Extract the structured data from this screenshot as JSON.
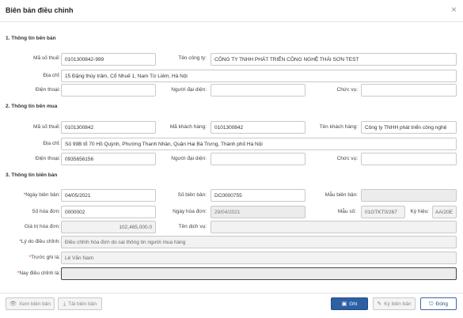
{
  "dialog": {
    "title": "Biên bản điều chỉnh"
  },
  "seller": {
    "section_title": "1. Thông tin bên bán",
    "tax_code_label": "Mã số thuế:",
    "tax_code": "0101300842-999",
    "company_label": "Tên công ty:",
    "company": "CÔNG TY TNHH PHÁT TRIỂN CÔNG NGHỆ THÁI SƠN TEST",
    "address_label": "Địa chỉ:",
    "address": "15 Đặng thùy trâm, Cổ Nhuế 1, Nam Từ Liêm, Hà Nội",
    "phone_label": "Điện thoại:",
    "phone": "",
    "rep_label": "Người đại diện:",
    "rep": "",
    "position_label": "Chức vụ:",
    "position": ""
  },
  "buyer": {
    "section_title": "2. Thông tin bên mua",
    "tax_code_label": "Mã số thuế:",
    "tax_code": "0101300842",
    "customer_code_label": "Mã khách hàng:",
    "customer_code": "0101300842",
    "customer_name_label": "Tên khách hàng:",
    "customer_name": "Công ty TNHH phát triển công nghệ",
    "address_label": "Địa chỉ:",
    "address": "Số 99B tổ 70 Hồ Quỳnh, Phường Thanh Nhàn, Quận Hai Bà Trưng, Thành phố Hà Nội",
    "phone_label": "Điện thoại:",
    "phone": "0935656156",
    "rep_label": "Người đại diện:",
    "rep": "",
    "position_label": "Chức vụ:",
    "position": ""
  },
  "record": {
    "section_title": "3. Thông tin biên bản",
    "date_label": "Ngày biên bản:",
    "date": "04/05/2021",
    "number_label": "Số biên bản:",
    "number": "DC0000755",
    "template_label": "Mẫu biên bản:",
    "template": "",
    "invoice_no_label": "Số hóa đơn:",
    "invoice_no": "0000002",
    "invoice_date_label": "Ngày hóa đơn:",
    "invoice_date": "29/04/2021",
    "form_label": "Mẫu số:",
    "form": "01GTKT0/267",
    "symbol_label": "Ký hiệu:",
    "symbol": "AA/20E",
    "value_label": "Giá trị hóa đơn:",
    "value": "102,465,000.0",
    "service_label": "Tên dịch vụ:",
    "service": "",
    "reason_label": "Lý do điều chỉnh:",
    "reason": "Điều chỉnh hóa đơn do sai thông tin người mua hàng",
    "before_label": "Trước ghi là:",
    "before": "Lê Văn Nam",
    "after_label": "Nay điều chỉnh là:",
    "after": ""
  },
  "footer": {
    "view_label": "Xem biên bản",
    "download_label": "Tải biên bản",
    "save_label": "Ghi",
    "sign_label": "Ký biên bản",
    "close_label": "Đóng"
  }
}
